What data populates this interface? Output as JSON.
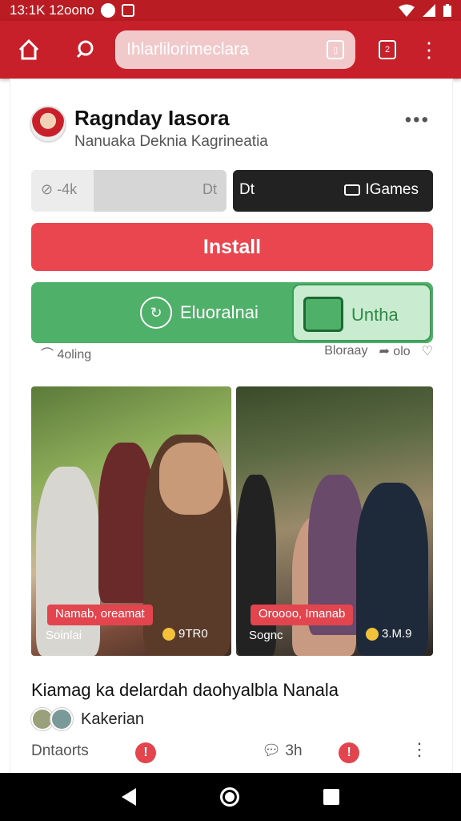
{
  "status_bar": {
    "time": "13:1K 12oono"
  },
  "toolbar": {
    "url_text": "Ihlarlilorimeclara",
    "tab_count": "2"
  },
  "post": {
    "author_name": "Ragnday Iasora",
    "author_sub": "Nanuaka Deknia Kagrineatia",
    "more": "•••",
    "progress": {
      "left": "-4k",
      "right": "Dt",
      "fill_fraction": 0.32
    },
    "dark_button": {
      "left": "Dt",
      "right": "IGames"
    },
    "install_label": "Install",
    "green_button": {
      "left_label": "Eluoralnai",
      "right_label": "Unthа"
    },
    "meta": {
      "left": "4oling",
      "right": "Bloraay",
      "count": "olo"
    }
  },
  "photos": [
    {
      "tag": "Namab, oreamat",
      "caption": "Soinlai",
      "coin": "9TR0"
    },
    {
      "tag": "Oroooo, Imanab",
      "caption": "Sognc",
      "coin": "3.M.9"
    }
  ],
  "article": {
    "title": "Kiamag ka delardah daohyalbla Nanala",
    "authors_label": "Kakerian",
    "actions": {
      "left": "Dntaorts",
      "comments": "3h"
    }
  },
  "colors": {
    "brand": "#c8202a",
    "install": "#ea4650",
    "green": "#4fb069"
  }
}
